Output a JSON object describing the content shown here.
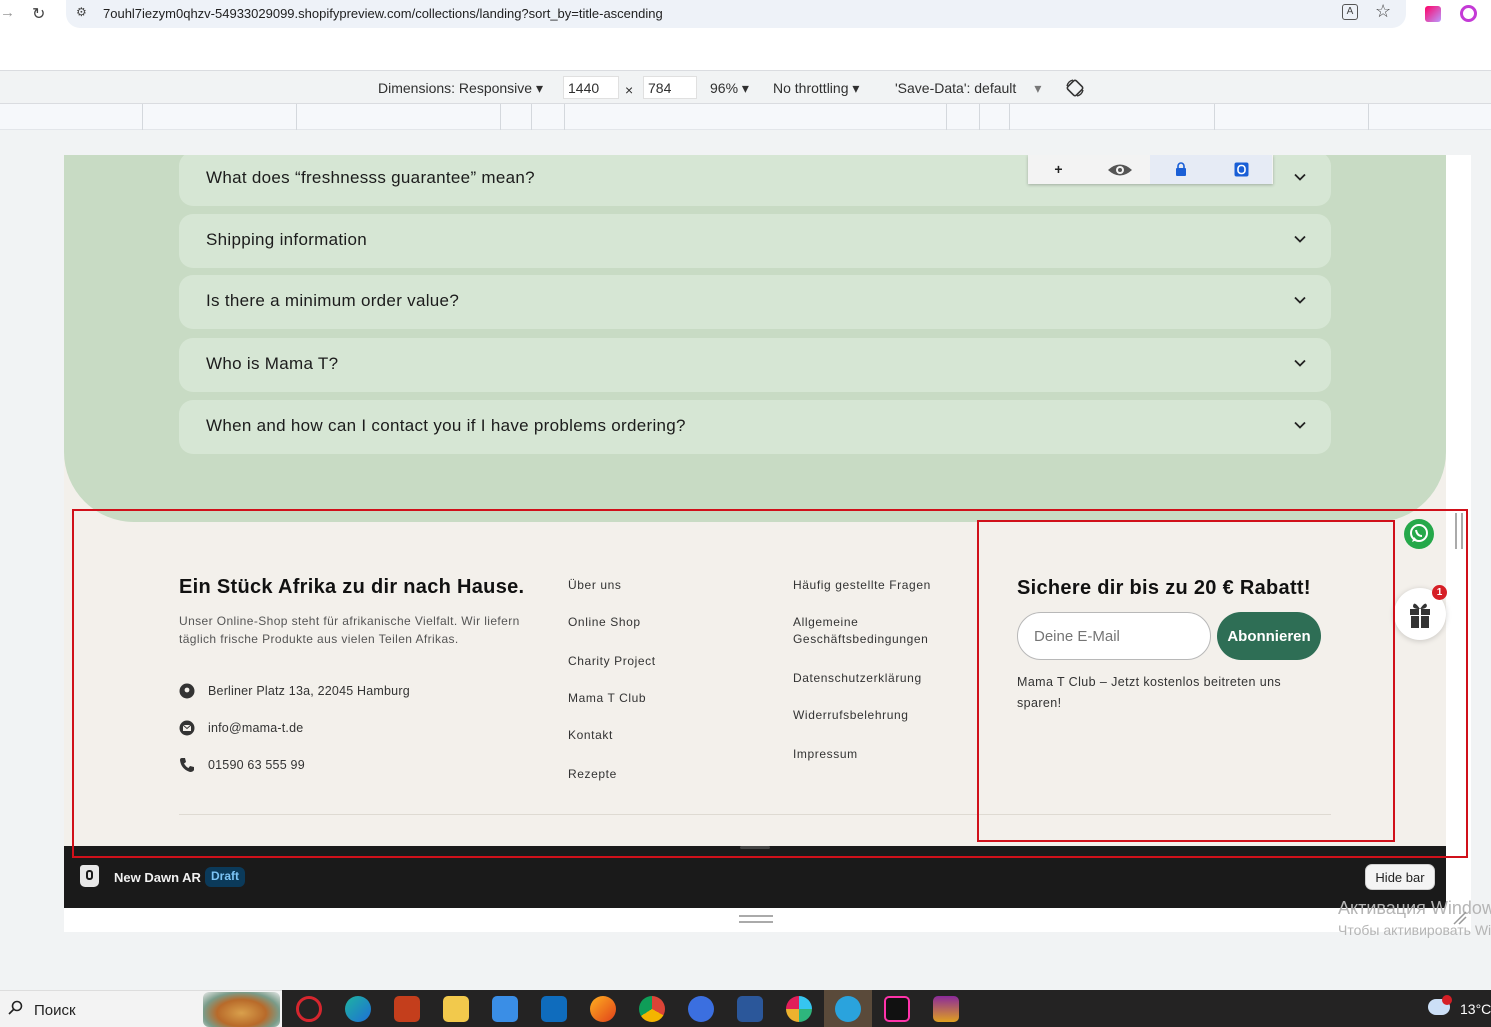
{
  "browser": {
    "url": "7ouhl7iezym0qhzv-54933029099.shopifypreview.com/collections/landing?sort_by=title-ascending"
  },
  "devtools": {
    "dimensions_label": "Dimensions: Responsive",
    "width_value": "1440",
    "times": "×",
    "height_value": "784",
    "zoom": "96%",
    "throttling": "No throttling",
    "save_data": "'Save-Data': default"
  },
  "floating_toolbar": {
    "plus": "+"
  },
  "faq": {
    "items": [
      {
        "question": "What does “freshnesss guarantee” mean?"
      },
      {
        "question": "Shipping information"
      },
      {
        "question": "Is there a minimum order value?"
      },
      {
        "question": "Who is Mama T?"
      },
      {
        "question": "When and how can I contact you if I have problems ordering?"
      }
    ]
  },
  "footer": {
    "brand_title": "Ein Stück Afrika zu dir nach Hause.",
    "brand_text": "Unser Online-Shop steht für afrikanische Vielfalt. Wir liefern täglich frische Produkte aus vielen Teilen Afrikas.",
    "address": "Berliner Platz 13a, 22045 Hamburg",
    "email": "info@mama-t.de",
    "phone": "01590 63 555 99",
    "links_col1": [
      "Über uns",
      "Online Shop",
      "Charity Project",
      "Mama T Club",
      "Kontakt",
      "Rezepte"
    ],
    "links_col2": [
      "Häufig gestellte Fragen",
      "Allgemeine Geschäftsbedingungen",
      "Datenschutzerklärung",
      "Widerrufsbelehrung",
      "Impressum"
    ],
    "newsletter_title": "Sichere dir bis zu 20 € Rabatt!",
    "email_placeholder": "Deine E-Mail",
    "subscribe_label": "Abonnieren",
    "newsletter_note": "Mama T Club – Jetzt kostenlos beitreten uns sparen!"
  },
  "preview_bar": {
    "theme_name": "New Dawn AR",
    "badge": "Draft",
    "hide_label": "Hide bar"
  },
  "widgets": {
    "gift_count": "1"
  },
  "os": {
    "activation_line1": "Активация Windows",
    "activation_line2": "Чтобы активировать Windows",
    "search_label": "Поиск",
    "temperature": "13°C"
  },
  "colors": {
    "faq_panel": "#c8dbc4",
    "faq_item": "#d6e6d4",
    "footer_bg": "#f3f0eb",
    "subscribe_button": "#2e6e55",
    "annotation": "#d0101a"
  }
}
